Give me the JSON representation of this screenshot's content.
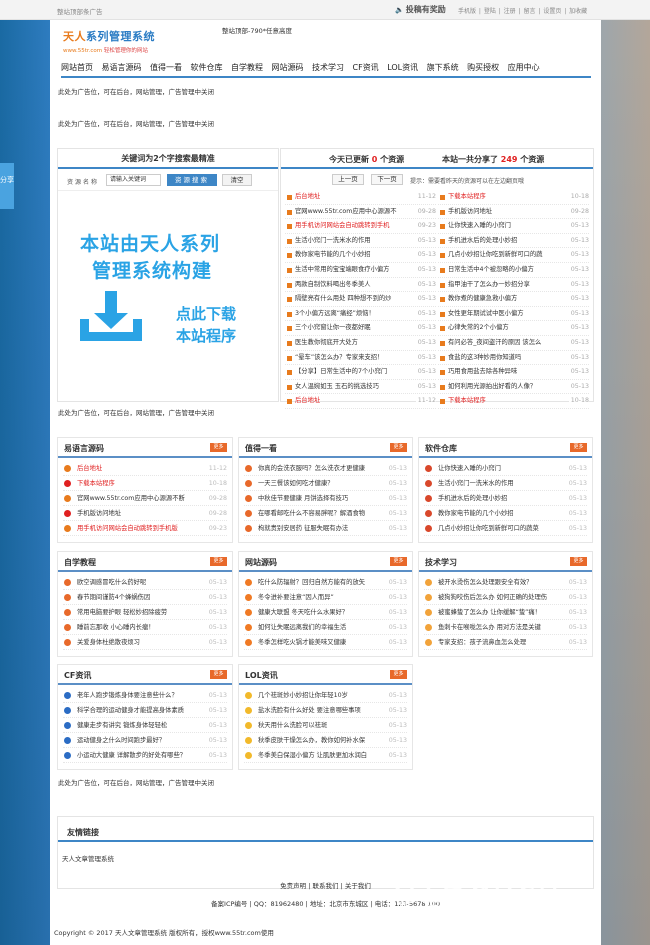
{
  "topbar": {
    "left": "整站顶部条广告",
    "tougao": "投稿有奖励",
    "links": "手机版 | 登陆 | 注册 | 留言 | 设置页 | 加收藏"
  },
  "side_tab": "分享",
  "logo": {
    "title_a": "天人",
    "title_b": "系列管理系统",
    "sub_a": "www.55tr.com",
    "sub_b": "轻松管理你的网站"
  },
  "header_ad": "整站顶部-790*任意高度",
  "nav": [
    "网站首页",
    "易语言源码",
    "值得一看",
    "软件仓库",
    "自学教程",
    "网站源码",
    "技术学习",
    "CF资讯",
    "LOL资讯",
    "旗下系统",
    "购买授权",
    "应用中心"
  ],
  "ad_text": "此处为广告位，可在后台，网站管理，广告管理中关闭",
  "search_box": {
    "title": "关键词为2个字搜索最精准",
    "label": "资源名称",
    "input_value": "请输入关键词",
    "search_btn": "资源搜索",
    "clear_btn": "清空"
  },
  "promo": {
    "line1": "本站由天人系列",
    "line2": "管理系统构建",
    "line3": "点此下载",
    "line4": "本站程序"
  },
  "updates": {
    "today_a": "今天已更新",
    "today_n": "0",
    "today_b": "个资源",
    "total_a": "本站一共分享了",
    "total_n": "249",
    "total_b": "个资源",
    "prev": "上一页",
    "next": "下一页",
    "tip": "提示：需要看昨天的资源可以在左边翻页哦"
  },
  "left_list": [
    {
      "t": "后台地址",
      "d": "11-12",
      "red": true
    },
    {
      "t": "官网www.55tr.com应用中心源源不",
      "d": "09-28"
    },
    {
      "t": "用手机访问网站会自动跳转到手机",
      "d": "09-23",
      "red": true
    },
    {
      "t": "生活小窍门一洗米水的作用",
      "d": "05-13"
    },
    {
      "t": "教你家电节能的几个小妙招",
      "d": "05-13"
    },
    {
      "t": "生活中常用的宝宝端眼食疗小偏方",
      "d": "05-13"
    },
    {
      "t": "两款自制饮料喝出冬季美人",
      "d": "05-13"
    },
    {
      "t": "隔壁亮有什么用处 四种想不到的炒",
      "d": "05-13"
    },
    {
      "t": "3个小偏方远离“痛经”烦恼！",
      "d": "05-13"
    },
    {
      "t": "三个小窍窗让你一夜都好眠",
      "d": "05-13"
    },
    {
      "t": "医生教你彻底开大处方",
      "d": "05-13"
    },
    {
      "t": "“晕车”该怎么办？专家来支招！",
      "d": "05-13"
    },
    {
      "t": "【分享】日常生活中的7个小窍门",
      "d": "05-13"
    },
    {
      "t": "女人温婉如玉 玉石的挑选技巧",
      "d": "05-13"
    },
    {
      "t": "后台地址",
      "d": "11-12",
      "red": true
    }
  ],
  "right_list": [
    {
      "t": "下载本站程序",
      "d": "10-18",
      "red": true
    },
    {
      "t": "手机版访问地址",
      "d": "09-28"
    },
    {
      "t": "让你快速入睡的小窍门",
      "d": "05-13"
    },
    {
      "t": "手机进水后的处理小妙招",
      "d": "05-13"
    },
    {
      "t": "几点小妙招让你吃到新鲜可口的蔬",
      "d": "05-13"
    },
    {
      "t": "日常生活中4个被忽略的小偏方",
      "d": "05-13"
    },
    {
      "t": "指甲油干了怎么办一妙招分享",
      "d": "05-13"
    },
    {
      "t": "教你煮的健康急救小偏方",
      "d": "05-13"
    },
    {
      "t": "女性更年期试试中医小偏方",
      "d": "05-13"
    },
    {
      "t": "心律失常的2个小偏方",
      "d": "05-13"
    },
    {
      "t": "有问必答_夜间盗汗的原因 该怎么",
      "d": "05-13"
    },
    {
      "t": "食盐的这3种妙用你知道吗",
      "d": "05-13"
    },
    {
      "t": "巧用食用盐去除各种异味",
      "d": "05-13"
    },
    {
      "t": "如何利用光源拍出好看的人像？",
      "d": "05-13"
    },
    {
      "t": "下载本站程序",
      "d": "10-18",
      "red": true
    }
  ],
  "more": "更多",
  "sections": [
    {
      "title": "易语言源码",
      "items": [
        {
          "t": "后台地址",
          "d": "11-12",
          "red": true
        },
        {
          "t": "下载本站程序",
          "d": "10-18",
          "red": true
        },
        {
          "t": "官网www.55tr.com应用中心源源不断",
          "d": "09-28"
        },
        {
          "t": "手机版访问地址",
          "d": "09-28"
        },
        {
          "t": "用手机访问网站会自动跳转到手机版",
          "d": "09-23",
          "red": true
        }
      ]
    },
    {
      "title": "值得一看",
      "items": [
        {
          "t": "你真的会洗衣服吗？怎么洗衣才更健康",
          "d": "05-13"
        },
        {
          "t": "一天三餐该如何吃才健康？",
          "d": "05-13"
        },
        {
          "t": "中秋佳节要健康 月饼选择有技巧",
          "d": "05-13"
        },
        {
          "t": "在哪看邮吃什么不容易胖呢？解酒食物",
          "d": "05-13"
        },
        {
          "t": "枸就贵别安居药 征服失眠有办法",
          "d": "05-13"
        }
      ]
    },
    {
      "title": "软件仓库",
      "items": [
        {
          "t": "让你快速入睡的小窍门",
          "d": "05-13"
        },
        {
          "t": "生活小窍门一洗米水的作用",
          "d": "05-13"
        },
        {
          "t": "手机进水后的处理小妙招",
          "d": "05-13"
        },
        {
          "t": "教你家电节能的几个小妙招",
          "d": "05-13"
        },
        {
          "t": "几点小妙招让你吃到新鲜可口的蔬菜",
          "d": "05-13"
        }
      ]
    },
    {
      "title": "自学教程",
      "items": [
        {
          "t": "欧空调感冒吃什么药好呢",
          "d": "05-13"
        },
        {
          "t": "春节期间谨防4个蜂蜗伤因",
          "d": "05-13"
        },
        {
          "t": "常用电脑要护眼 轻松妙招除疲劳",
          "d": "05-13"
        },
        {
          "t": "睡前忘那收 小心睡内长瘤！",
          "d": "05-13"
        },
        {
          "t": "关爱身体杜绝散夜烦习",
          "d": "05-13"
        }
      ]
    },
    {
      "title": "网站源码",
      "items": [
        {
          "t": "吃什么防辐射？回归自然方能有的放矢",
          "d": "05-13"
        },
        {
          "t": "冬令进补要注意“因人而异”",
          "d": "05-13"
        },
        {
          "t": "健康大联盟 冬天吃什么水果好？",
          "d": "05-13"
        },
        {
          "t": "如何让失眠远离我们的幸福生活",
          "d": "05-13"
        },
        {
          "t": "冬季怎样吃火锅才能美味又健康",
          "d": "05-13"
        }
      ]
    },
    {
      "title": "技术学习",
      "items": [
        {
          "t": "被开水烫伤怎么处理跟安全有效？",
          "d": "05-13"
        },
        {
          "t": "被狗狗咬伤后怎么办 如何正确的处理伤",
          "d": "05-13"
        },
        {
          "t": "被蜜蜂蛰了怎么办 让你缓解“蛰”痛！",
          "d": "05-13"
        },
        {
          "t": "鱼刺卡在喉咙怎么办 用对方法是关键",
          "d": "05-13"
        },
        {
          "t": "专家支招：孩子流鼻血怎么处理",
          "d": "05-13"
        }
      ]
    },
    {
      "title": "CF资讯",
      "items": [
        {
          "t": "老年人跑步锻炼身体要注意些什么？",
          "d": "05-13"
        },
        {
          "t": "科学合理的运动健身才能提高身体素质",
          "d": "05-13"
        },
        {
          "t": "健康走步有讲究 锻炼身体轻轻松",
          "d": "05-13"
        },
        {
          "t": "运动健身之什么时间跑步最好？",
          "d": "05-13"
        },
        {
          "t": "小运动大健康 详解散步的好处有哪些？",
          "d": "05-13"
        }
      ]
    },
    {
      "title": "LOL资讯",
      "items": [
        {
          "t": "几个祛斑妙小妙招让你年轻10岁",
          "d": "05-13"
        },
        {
          "t": "盐水洗脸有什么好处 要注意哪些事项",
          "d": "05-13"
        },
        {
          "t": "秋天用什么洗脸可以祛斑",
          "d": "05-13"
        },
        {
          "t": "秋季皮肤干燥怎么办，教你如何补水保",
          "d": "05-13"
        },
        {
          "t": "冬季美白保湿小偏方 让肌肤更加水润白",
          "d": "05-13"
        }
      ]
    }
  ],
  "friend_links": {
    "title": "友情链接",
    "item": "天人文章管理系统"
  },
  "footer": {
    "links": "免责声明 | 联系我们 | 关于我们",
    "info": "备案ICP编号 | QQ：81962480 | 地址：北京市东城区 | 电话：123-5678 100",
    "copyright": "Copyright © 2017 天人文章管理系统 版权所有，授权www.55tr.com使用"
  },
  "watermark": {
    "line1": "XYDai.cn",
    "line2": "新源代源码社区"
  }
}
